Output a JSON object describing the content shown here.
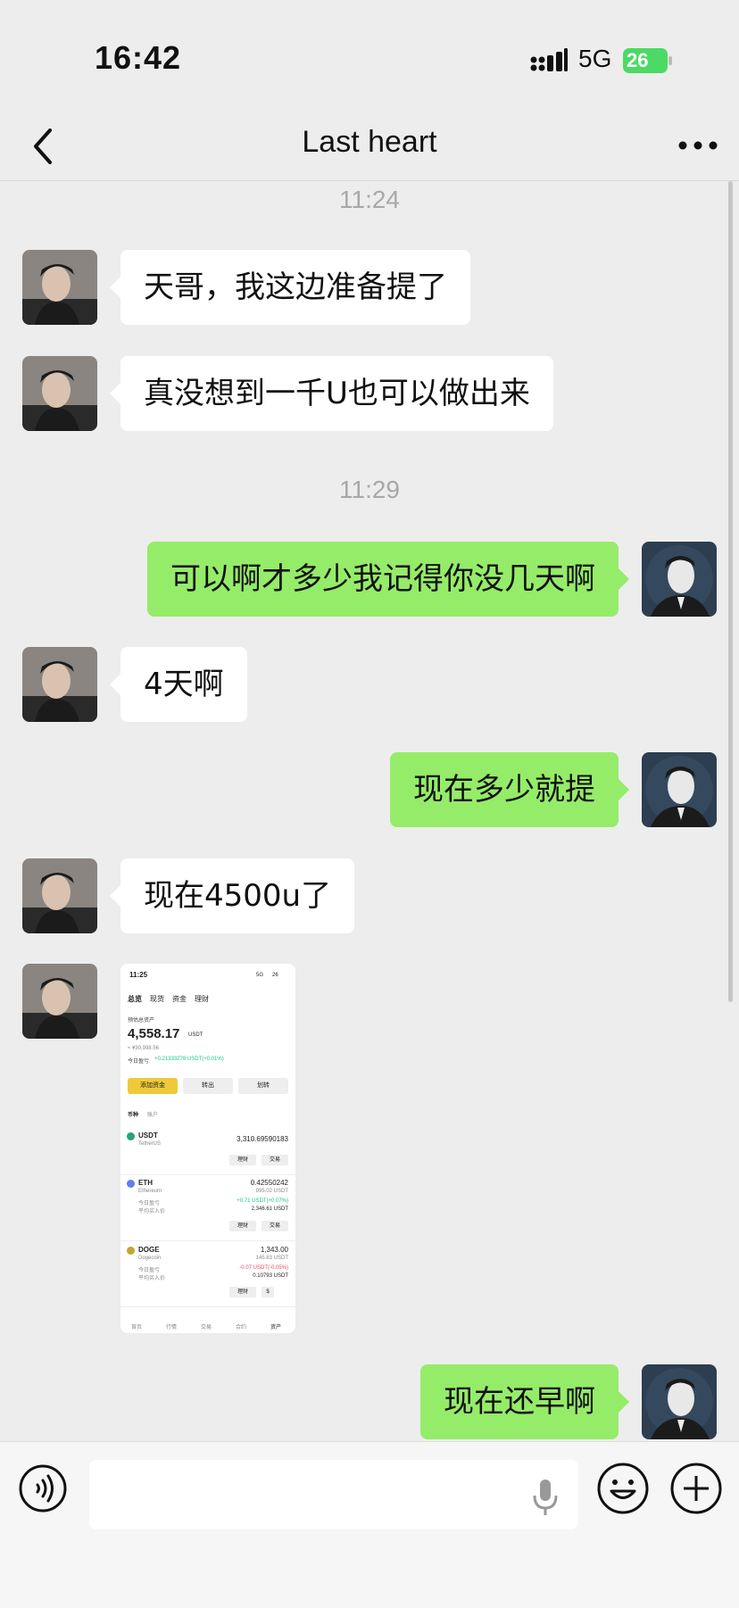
{
  "status_bar": {
    "time": "16:42",
    "network": "5G",
    "battery": "26"
  },
  "header": {
    "title": "Last heart"
  },
  "messages": [
    {
      "type": "timestamp",
      "text": "11:24"
    },
    {
      "side": "left",
      "text": "天哥，我这边准备提了"
    },
    {
      "side": "left",
      "text": "真没想到一千U也可以做出来"
    },
    {
      "type": "timestamp",
      "text": "11:29"
    },
    {
      "side": "right",
      "text": "可以啊才多少我记得你没几天啊"
    },
    {
      "side": "left",
      "text": "4天啊"
    },
    {
      "side": "right",
      "text": "现在多少就提"
    },
    {
      "side": "left",
      "text": "现在4500u了"
    },
    {
      "side": "left",
      "type": "image"
    },
    {
      "side": "right",
      "text": "现在还早啊"
    }
  ],
  "shared_screenshot": {
    "time": "11:25",
    "network": "5G",
    "battery": "26",
    "tabs": [
      "总览",
      "现货",
      "资金",
      "理财"
    ],
    "estimated_label": "预估总资产",
    "total": "4,558.17",
    "total_unit": "USDT",
    "total_cny": "≈ ¥30,998.56",
    "pnl_label": "今日盈亏",
    "pnl_value": "+0.21333278 USDT(+0.01%)",
    "buttons": [
      "添加资金",
      "转出",
      "划转"
    ],
    "list_tabs": [
      "币种",
      "账户"
    ],
    "coins": [
      {
        "symbol": "USDT",
        "name": "TetherUS",
        "amount": "3,310.69590183",
        "sub": "",
        "pnl_label": "",
        "pnl": "",
        "cost_label": "",
        "cost": "",
        "actions": [
          "理财",
          "交易"
        ],
        "color": "#26a17b"
      },
      {
        "symbol": "ETH",
        "name": "Ethereum",
        "amount": "0.42550242",
        "sub": "995.02 USDT",
        "pnl_label": "今日盈亏",
        "pnl": "+0.71 USDT(+0.07%)",
        "cost_label": "平均买入价",
        "cost": "2,346.61 USDT",
        "actions": [
          "理财",
          "交易"
        ],
        "color": "#627eea"
      },
      {
        "symbol": "DOGE",
        "name": "Dogecoin",
        "amount": "1,343.00",
        "sub": "145.83 USDT",
        "pnl_label": "今日盈亏",
        "pnl": "-0.07 USDT(-0.05%)",
        "cost_label": "平均买入价",
        "cost": "0.10793 USDT",
        "actions": [
          "理财",
          "$"
        ],
        "color": "#c2a633"
      }
    ],
    "bottom_nav": [
      "首页",
      "行情",
      "交易",
      "合约",
      "资产"
    ]
  },
  "colors": {
    "bubble_right": "#95ec69",
    "bubble_left": "#ffffff",
    "background": "#ededed"
  }
}
